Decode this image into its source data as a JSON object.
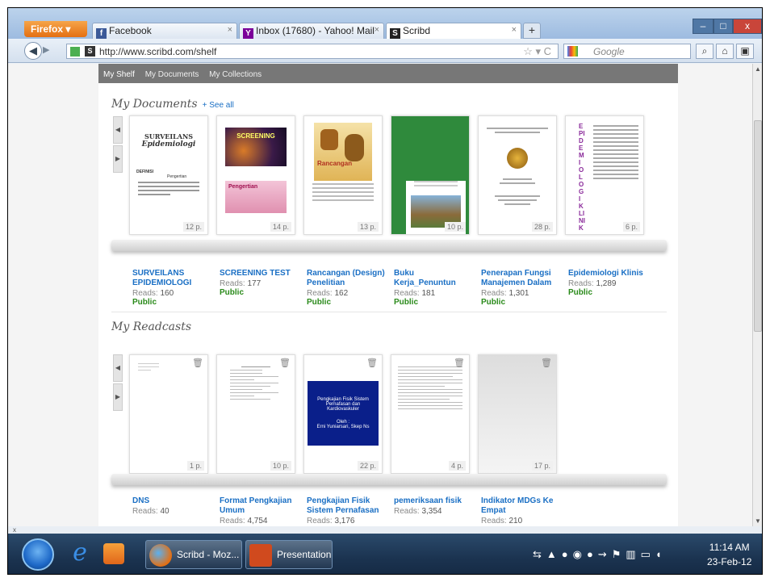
{
  "browser": {
    "firefox_label": "Firefox",
    "tabs": [
      {
        "label": "Facebook",
        "icon": "facebook-icon"
      },
      {
        "label": "Inbox (17680) - Yahoo! Mail",
        "icon": "yahoo-icon"
      },
      {
        "label": "Scribd",
        "icon": "scribd-icon"
      }
    ],
    "url": "http://www.scribd.com/shelf",
    "search_placeholder": "Google"
  },
  "subnav": {
    "items": [
      "My Shelf",
      "My Documents",
      "My Collections"
    ]
  },
  "documents": {
    "heading": "My Documents",
    "see_all": "+ See all",
    "items": [
      {
        "title": "SURVEILANS EPIDEMIOLOGI",
        "reads_label": "Reads:",
        "reads": "160",
        "status": "Public",
        "pages": "12 p.",
        "cover_text": [
          "SURVEILANS",
          "Epidemiologi",
          "DEFINISI",
          "Pengertian"
        ]
      },
      {
        "title": "SCREENING TEST",
        "reads_label": "Reads:",
        "reads": "177",
        "status": "Public",
        "pages": "14 p.",
        "cover_text": [
          "SCREENING",
          "Pengertian"
        ]
      },
      {
        "title": "Rancangan (Design) Penelitian",
        "reads_label": "Reads:",
        "reads": "162",
        "status": "Public",
        "pages": "13 p.",
        "cover_text": [
          "Rancangan"
        ]
      },
      {
        "title": "Buku Kerja_Penuntun",
        "reads_label": "Reads:",
        "reads": "181",
        "status": "Public",
        "pages": "10 p.",
        "cover_text": []
      },
      {
        "title": "Penerapan Fungsi Manajemen Dalam",
        "reads_label": "Reads:",
        "reads": "1,301",
        "status": "Public",
        "pages": "28 p.",
        "cover_text": []
      },
      {
        "title": "Epidemiologi Klinis",
        "reads_label": "Reads:",
        "reads": "1,289",
        "status": "Public",
        "pages": "6 p.",
        "cover_text": [
          "EPIDEMIOLOGI KLINIK"
        ]
      }
    ]
  },
  "readcasts": {
    "heading": "My Readcasts",
    "items": [
      {
        "title": "DNS",
        "reads_label": "Reads:",
        "reads": "40",
        "pages": "1 p."
      },
      {
        "title": "Format Pengkajian Umum",
        "reads_label": "Reads:",
        "reads": "4,754",
        "pages": "10 p."
      },
      {
        "title": "Pengkajian Fisik Sistem Pernafasan",
        "reads_label": "Reads:",
        "reads": "3,176",
        "pages": "22 p.",
        "cover_text": [
          "Pengkajian Fisik Sistem Pernafasan dan Kardiovaskuler",
          "Oleh :",
          "Erni Yuniarsari, Skep Ns"
        ]
      },
      {
        "title": "pemeriksaan fisik",
        "reads_label": "Reads:",
        "reads": "3,354",
        "pages": "4 p."
      },
      {
        "title": "Indikator MDGs Ke Empat",
        "reads_label": "Reads:",
        "reads": "210",
        "pages": "17 p."
      }
    ]
  },
  "statusbar": {
    "close_label": "x"
  },
  "taskbar": {
    "buttons": [
      {
        "label": "Scribd - Moz..."
      },
      {
        "label": "Presentation..."
      }
    ],
    "time": "11:14 AM",
    "date": "23-Feb-12"
  },
  "colors": {
    "link": "#1a6fc4",
    "public": "#2a8a1a"
  }
}
